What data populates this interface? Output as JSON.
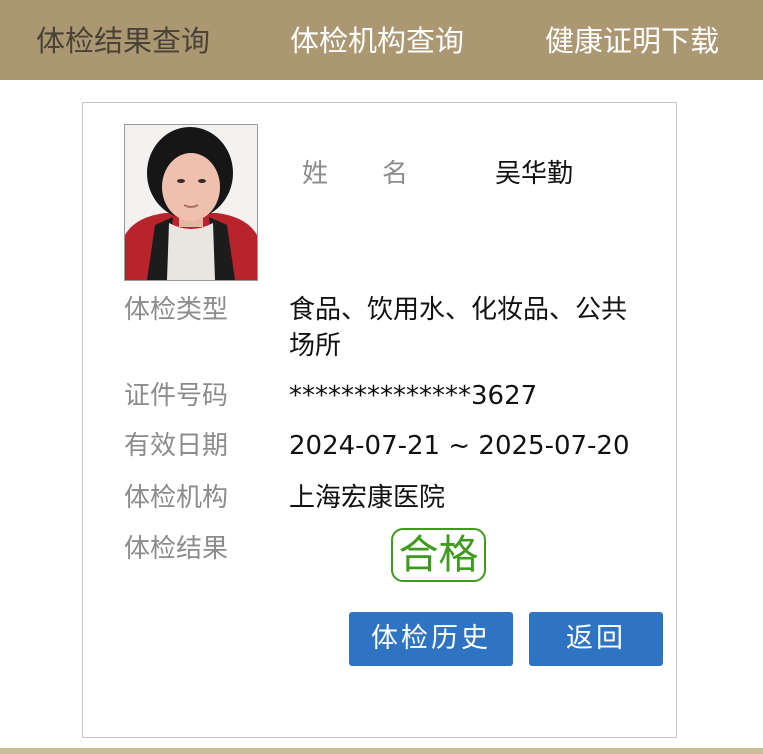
{
  "nav": {
    "tabs": [
      {
        "label": "体检结果查询"
      },
      {
        "label": "体检机构查询"
      },
      {
        "label": "健康证明下载"
      }
    ]
  },
  "record": {
    "name_label": "姓名",
    "name_value": "吴华勤",
    "rows": [
      {
        "label": "体检类型",
        "value": "食品、饮用水、化妆品、公共场所"
      },
      {
        "label": "证件号码",
        "value": "**************3627"
      },
      {
        "label": "有效日期",
        "value": "2024-07-21 ~ 2025-07-20"
      },
      {
        "label": "体检机构",
        "value": "上海宏康医院"
      },
      {
        "label": "体检结果",
        "value": ""
      }
    ],
    "result_stamp": "合格"
  },
  "buttons": {
    "history": "体检历史",
    "back": "返回"
  },
  "colors": {
    "nav_bg": "#ab9872",
    "button": "#2f74c2",
    "stamp": "#3f9a1e"
  }
}
